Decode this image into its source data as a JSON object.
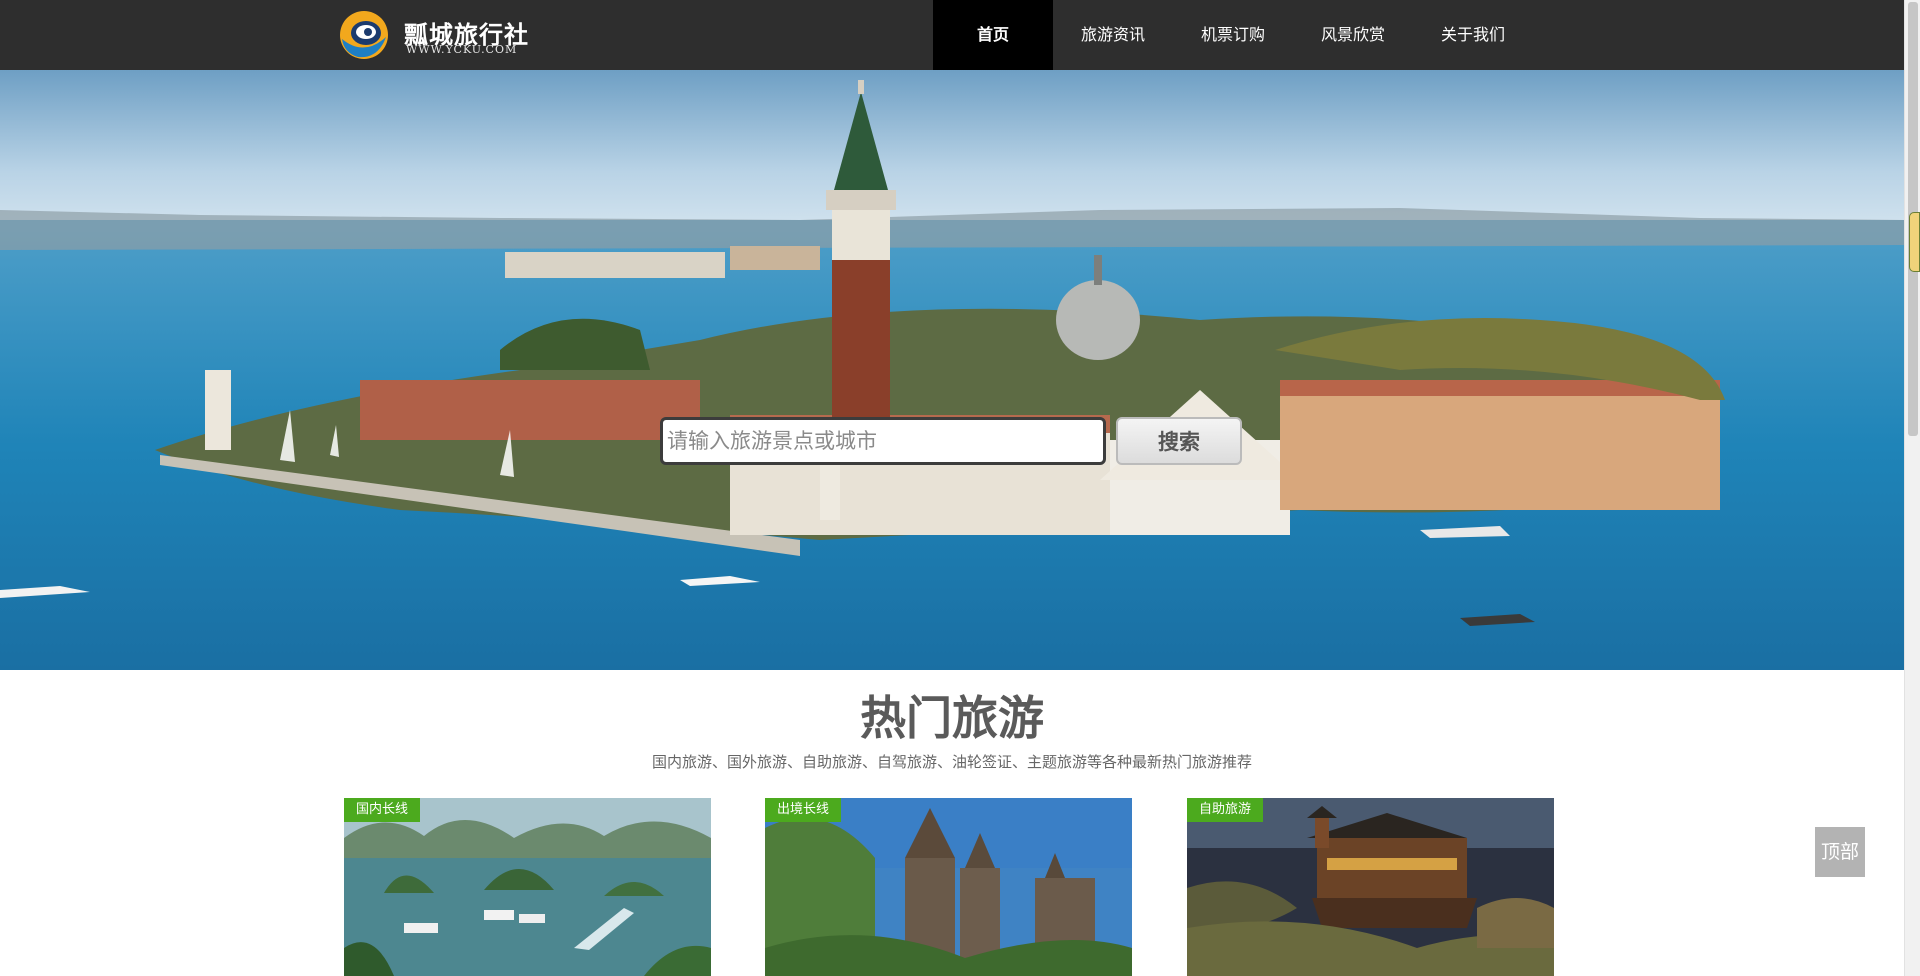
{
  "header": {
    "logo": {
      "title": "瓢城旅行社",
      "subtitle": "WWW.YCKU.COM"
    },
    "nav": [
      {
        "label": "首页",
        "active": true
      },
      {
        "label": "旅游资讯",
        "active": false
      },
      {
        "label": "机票订购",
        "active": false
      },
      {
        "label": "风景欣赏",
        "active": false
      },
      {
        "label": "关于我们",
        "active": false
      }
    ]
  },
  "search": {
    "placeholder": "请输入旅游景点或城市",
    "button_label": "搜索"
  },
  "section": {
    "title": "热门旅游",
    "subtitle": "国内旅游、国外旅游、自助旅游、自驾旅游、油轮签证、主题旅游等各种最新热门旅游推荐"
  },
  "cards": [
    {
      "tag": "国内长线"
    },
    {
      "tag": "出境长线"
    },
    {
      "tag": "自助旅游"
    }
  ],
  "back_to_top": "顶部",
  "colors": {
    "header_bg": "#2e2e2e",
    "nav_active_bg": "#000000",
    "tag_bg": "#4caa1e",
    "back_to_top_bg": "#b3b3b3"
  }
}
